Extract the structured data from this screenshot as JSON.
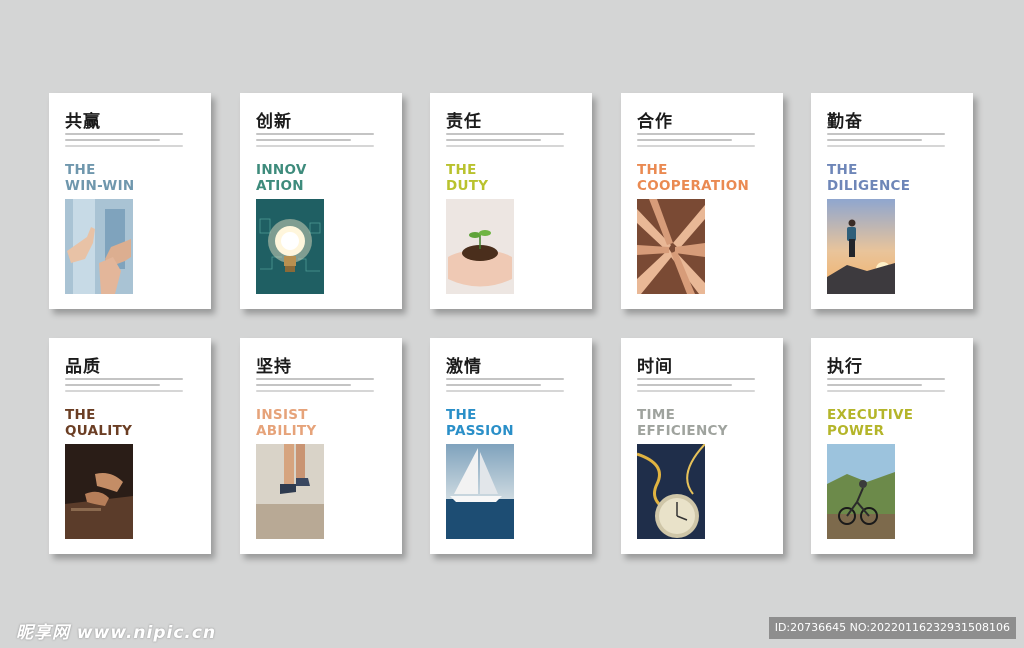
{
  "cards": [
    {
      "title": "共赢",
      "en1": "THE",
      "en2": "WIN-WIN",
      "color": "#6f97ad",
      "photo": "handshake-thumbs-photo"
    },
    {
      "title": "创新",
      "en1": "INNOV",
      "en2": "ATION",
      "color": "#3e8b7c",
      "photo": "lightbulb-photo"
    },
    {
      "title": "责任",
      "en1": "THE",
      "en2": "DUTY",
      "color": "#b9c22e",
      "photo": "sprout-in-hands-photo"
    },
    {
      "title": "合作",
      "en1": "THE",
      "en2": "COOPERATION",
      "color": "#ea8a52",
      "photo": "stacked-hands-photo"
    },
    {
      "title": "勤奋",
      "en1": "THE",
      "en2": "DILIGENCE",
      "color": "#6e86b8",
      "photo": "hiker-summit-photo"
    },
    {
      "title": "品质",
      "en1": "THE",
      "en2": "QUALITY",
      "color": "#6b3e24",
      "photo": "craftsman-hands-photo"
    },
    {
      "title": "坚持",
      "en1": "INSIST",
      "en2": "ABILITY",
      "color": "#e6a37a",
      "photo": "runner-feet-photo"
    },
    {
      "title": "激情",
      "en1": "THE",
      "en2": "PASSION",
      "color": "#2a8fc8",
      "photo": "sailboat-photo"
    },
    {
      "title": "时间",
      "en1": "TIME",
      "en2": "EFFICIENCY",
      "color": "#9fa39e",
      "photo": "clock-illustration-photo"
    },
    {
      "title": "执行",
      "en1": "EXECUTIVE",
      "en2": "POWER",
      "color": "#b4b52a",
      "photo": "mountain-biker-photo"
    }
  ],
  "watermark": {
    "brand": "昵享网 www.nipic.cn",
    "id_text": "ID:20736645 NO:20220116232931508106"
  }
}
